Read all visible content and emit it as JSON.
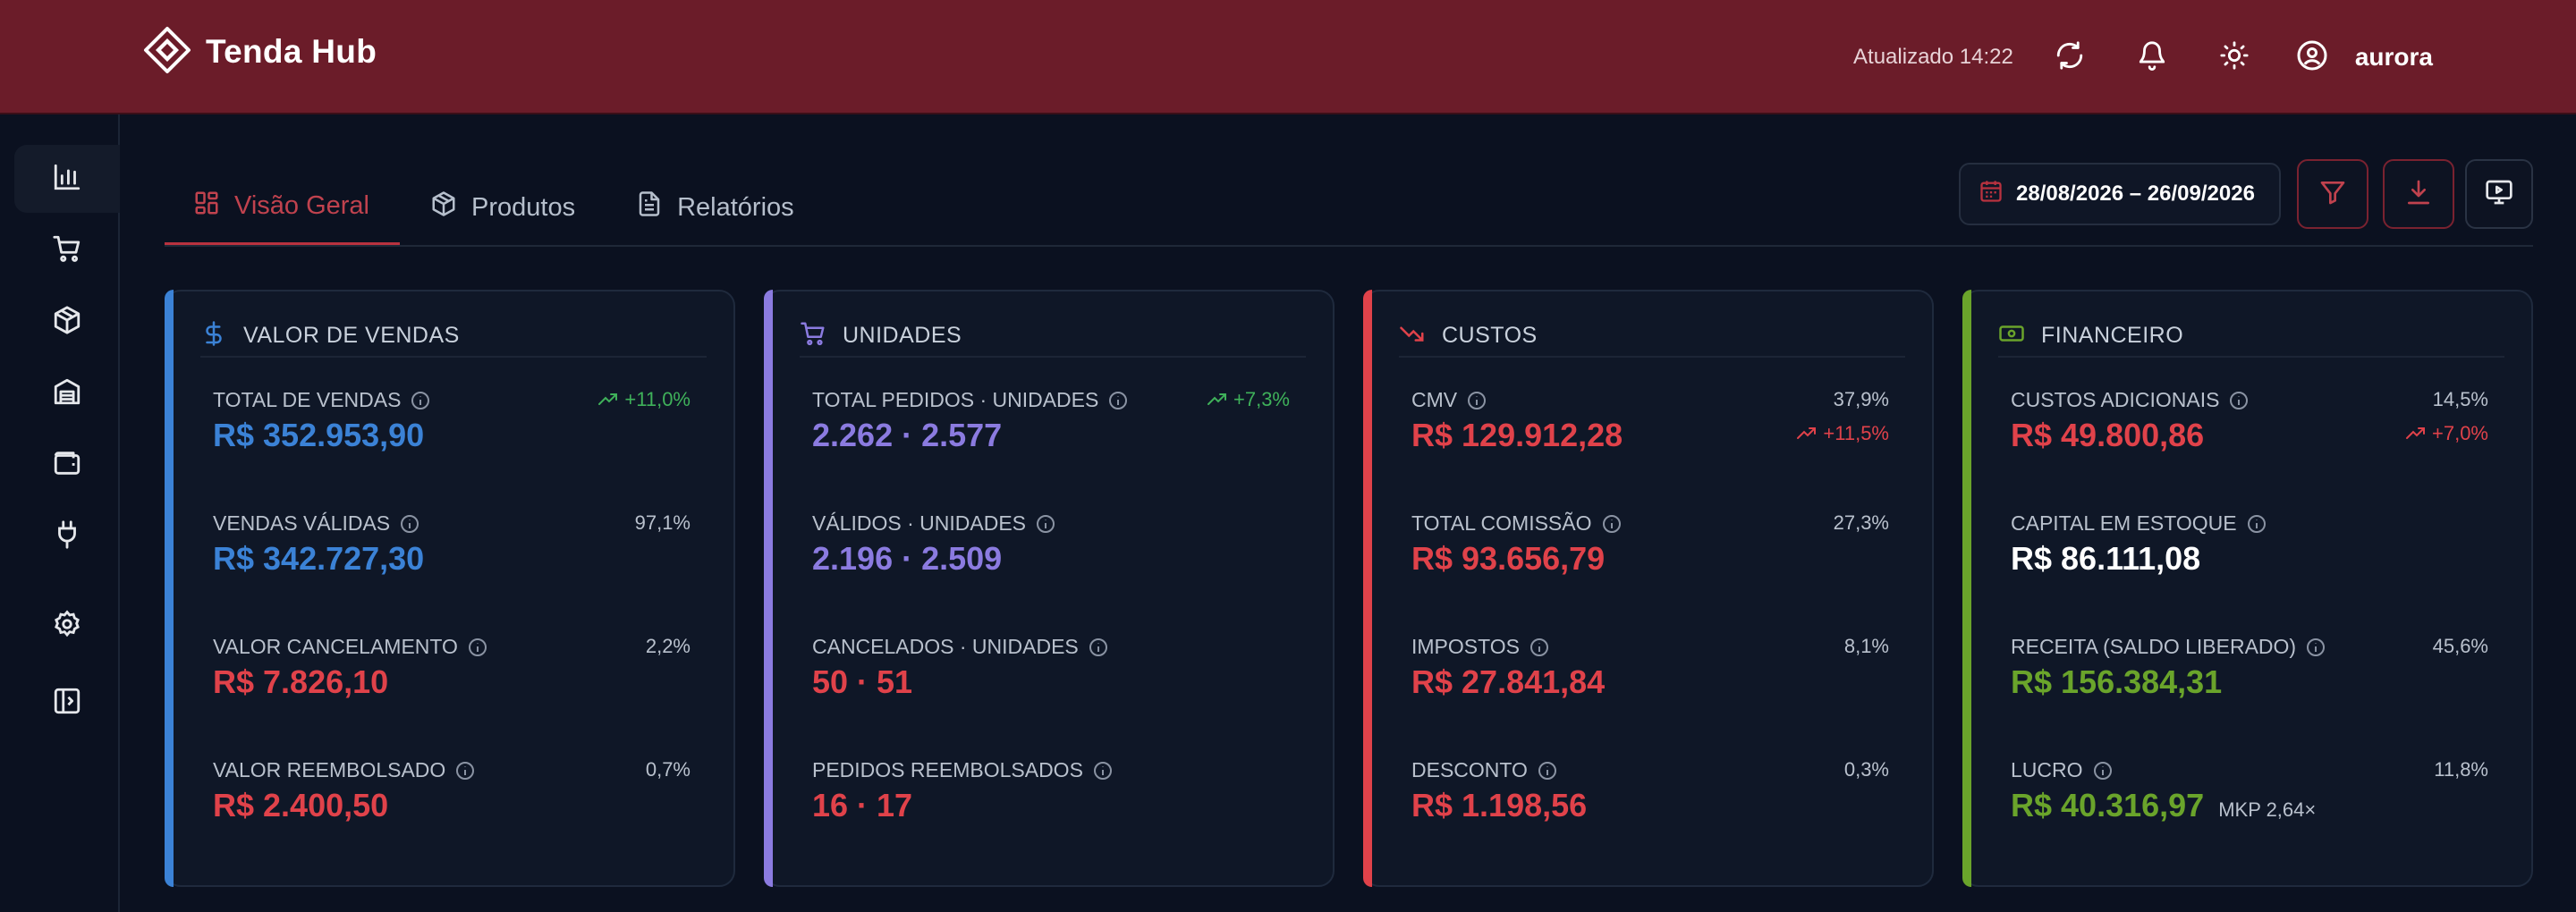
{
  "app": {
    "name": "Tenda Hub"
  },
  "header": {
    "updated": "Atualizado 14:22",
    "user": "aurora"
  },
  "tabs": [
    {
      "label": "Visão Geral",
      "active": true
    },
    {
      "label": "Produtos",
      "active": false
    },
    {
      "label": "Relatórios",
      "active": false
    }
  ],
  "toolbar": {
    "date_range": "28/08/2026 – 26/09/2026"
  },
  "colors": {
    "header_bg": "#6b1c29",
    "page_bg": "#0b1120",
    "blue": "#3b82d6",
    "purple": "#8b7be0",
    "red": "#e0424a",
    "green": "#6aa42b",
    "up_green": "#3fb15a"
  },
  "cards": [
    {
      "title": "VALOR DE VENDAS",
      "icon": "dollar-icon",
      "metrics": [
        {
          "label": "TOTAL DE VENDAS",
          "value": "R$ 352.953,90",
          "delta": "+11,0%"
        },
        {
          "label": "VENDAS VÁLIDAS",
          "value": "R$ 342.727,30",
          "pct": "97,1%"
        },
        {
          "label": "VALOR CANCELAMENTO",
          "value": "R$ 7.826,10",
          "pct": "2,2%"
        },
        {
          "label": "VALOR REEMBOLSADO",
          "value": "R$ 2.400,50",
          "pct": "0,7%"
        }
      ]
    },
    {
      "title": "UNIDADES",
      "icon": "cart-icon",
      "metrics": [
        {
          "label": "TOTAL PEDIDOS · UNIDADES",
          "value": "2.262 · 2.577",
          "delta": "+7,3%"
        },
        {
          "label": "VÁLIDOS · UNIDADES",
          "value": "2.196 · 2.509"
        },
        {
          "label": "CANCELADOS · UNIDADES",
          "value": "50 · 51"
        },
        {
          "label": "PEDIDOS REEMBOLSADOS",
          "value": "16 · 17"
        }
      ]
    },
    {
      "title": "CUSTOS",
      "icon": "trending-down-icon",
      "metrics": [
        {
          "label": "CMV",
          "value": "R$ 129.912,28",
          "pct": "37,9%",
          "delta": "+11,5%"
        },
        {
          "label": "TOTAL COMISSÃO",
          "value": "R$ 93.656,79",
          "pct": "27,3%"
        },
        {
          "label": "IMPOSTOS",
          "value": "R$ 27.841,84",
          "pct": "8,1%"
        },
        {
          "label": "DESCONTO",
          "value": "R$ 1.198,56",
          "pct": "0,3%"
        }
      ]
    },
    {
      "title": "FINANCEIRO",
      "icon": "banknote-icon",
      "metrics": [
        {
          "label": "CUSTOS ADICIONAIS",
          "value": "R$ 49.800,86",
          "pct": "14,5%",
          "delta": "+7,0%"
        },
        {
          "label": "CAPITAL EM ESTOQUE",
          "value": "R$ 86.111,08"
        },
        {
          "label": "RECEITA (SALDO LIBERADO)",
          "value": "R$ 156.384,31",
          "pct": "45,6%"
        },
        {
          "label": "LUCRO",
          "value": "R$ 40.316,97",
          "pct": "11,8%",
          "extra": "MKP 2,64×"
        }
      ]
    }
  ]
}
